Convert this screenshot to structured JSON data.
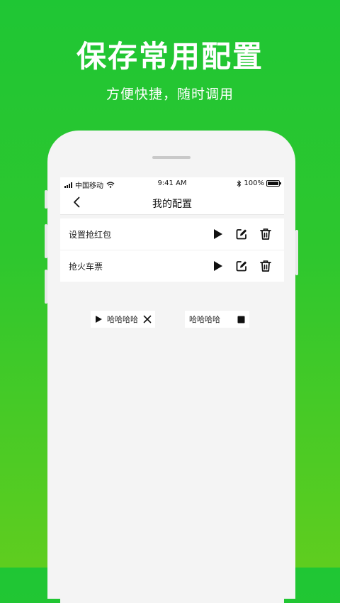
{
  "promo": {
    "headline": "保存常用配置",
    "subline": "方便快捷，随时调用"
  },
  "status_bar": {
    "carrier": "中国移动",
    "time": "9:41 AM",
    "battery": "100%",
    "battery_level": 1.0
  },
  "nav": {
    "title": "我的配置"
  },
  "configs": [
    {
      "label": "设置抢红包"
    },
    {
      "label": "抢火车票"
    }
  ],
  "floating": {
    "playing_label": "哈哈哈哈",
    "stopped_label": "哈哈哈哈"
  },
  "colors": {
    "brand_green": "#1fc634",
    "icon": "#111111"
  }
}
